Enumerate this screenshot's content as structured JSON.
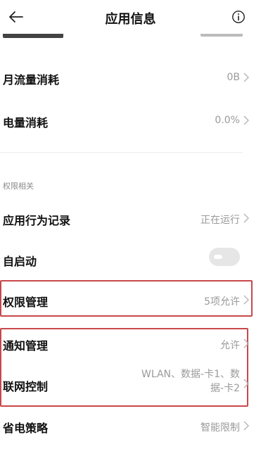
{
  "header": {
    "title": "应用信息",
    "back_icon": "arrow-left-icon",
    "info_icon": "info-circle-icon"
  },
  "rows": {
    "monthly_traffic": {
      "label": "月流量消耗",
      "value": "0B"
    },
    "battery": {
      "label": "电量消耗",
      "value": "0.0%"
    },
    "app_behavior": {
      "label": "应用行为记录",
      "value": "正在运行"
    },
    "autostart": {
      "label": "自启动",
      "enabled": false
    },
    "permissions": {
      "label": "权限管理",
      "value": "5项允许"
    },
    "notifications": {
      "label": "通知管理",
      "value": "允许"
    },
    "network": {
      "label": "联网控制",
      "value_line1": "WLAN、数据-卡1、数",
      "value_line2": "据-卡2"
    },
    "power_saving": {
      "label": "省电策略",
      "value": "智能限制"
    }
  },
  "section": {
    "permissions_title": "权限相关"
  },
  "colors": {
    "highlight": "#c8484b",
    "text": "#111111",
    "secondary": "#9a9a9a"
  }
}
